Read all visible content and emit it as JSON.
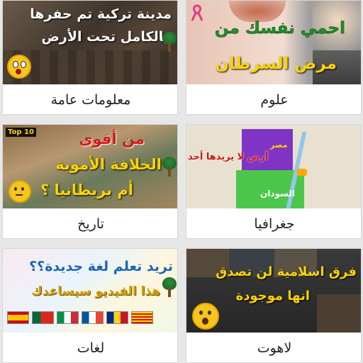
{
  "categories": [
    {
      "label": "معلومات عامة",
      "thumb_lines": [
        "مدينة تركية تم حفرها",
        "بالكامل تحت الأرض"
      ]
    },
    {
      "label": "علوم",
      "thumb_lines": [
        "احمي نفسك من",
        "مرض السرطان"
      ]
    },
    {
      "label": "تاريخ",
      "badge": "Top 10",
      "thumb_lines": [
        "من أقوى",
        "الخلافة الأموية",
        "أم بريطانيا ؟"
      ]
    },
    {
      "label": "جغرافيا",
      "map_labels": [
        "مصر",
        "أرض لا يريدها أحد",
        "السودان"
      ]
    },
    {
      "label": "لغات",
      "thumb_lines": [
        "تريد تعلم لغة جديدة؟؟",
        "هذا الفيديو سيساعدك"
      ]
    },
    {
      "label": "لاهوت",
      "thumb_lines": [
        "فرق اسلامية لن تصدق",
        "انها موجودة"
      ]
    }
  ],
  "colors": {
    "accent_yellow": "#ffd400",
    "accent_green": "#1e8f2a",
    "accent_red": "#c81818"
  },
  "icons": [
    "tree-icon",
    "ribbon-icon",
    "surprised-emoji-icon",
    "thinking-emoji-icon"
  ]
}
